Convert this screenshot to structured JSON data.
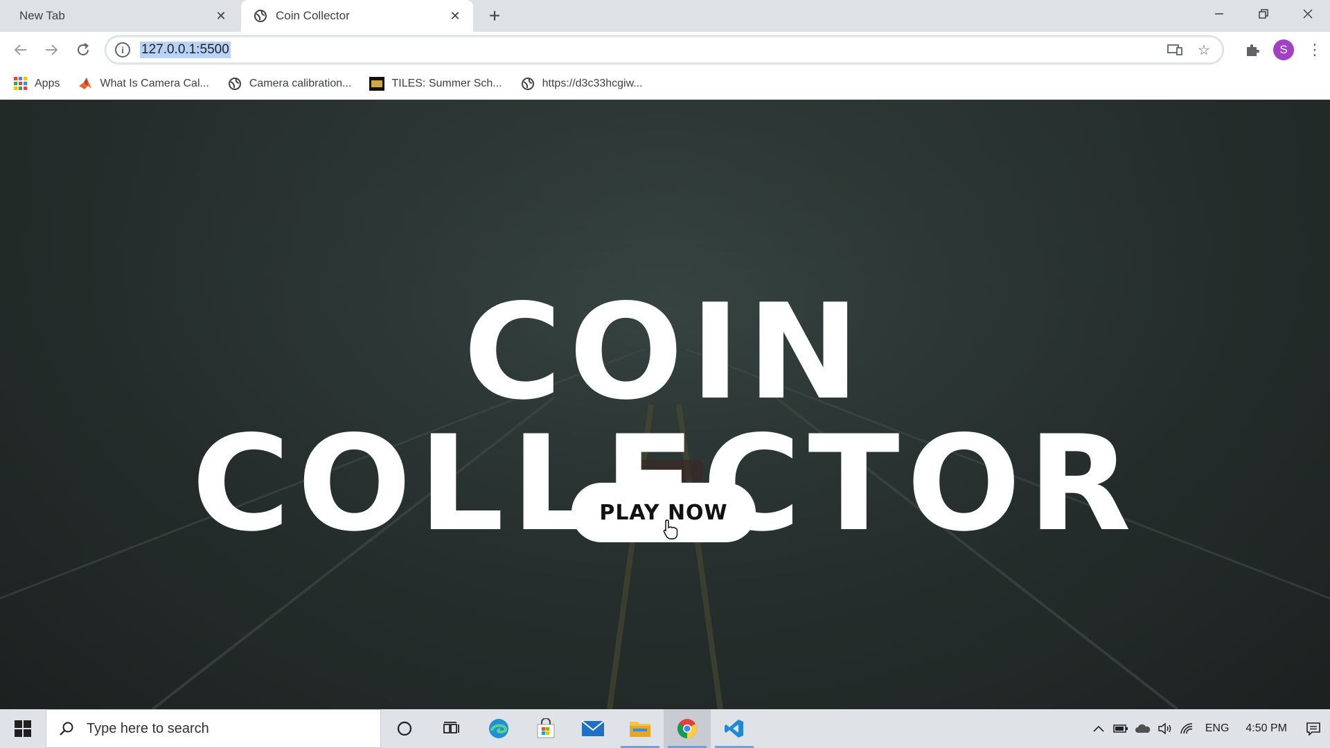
{
  "browser": {
    "tabs": [
      {
        "title": "New Tab",
        "active": false
      },
      {
        "title": "Coin Collector",
        "active": true
      }
    ],
    "new_tab_symbol": "+",
    "url": "127.0.0.1:5500",
    "bookmarks": [
      {
        "label": "Apps",
        "icon": "apps-grid-icon"
      },
      {
        "label": "What Is Camera Cal...",
        "icon": "matlab-icon"
      },
      {
        "label": "Camera calibration...",
        "icon": "globe-icon"
      },
      {
        "label": "TILES: Summer Sch...",
        "icon": "usc-icon"
      },
      {
        "label": "https://d3c33hcgiw...",
        "icon": "globe-icon"
      }
    ],
    "profile_initial": "S"
  },
  "game": {
    "title": "COIN COLLECTOR",
    "play_button": "PLAY NOW"
  },
  "taskbar": {
    "search_placeholder": "Type here to search",
    "language": "ENG",
    "time": "4:50 PM"
  },
  "colors": {
    "accent": "#1a73e8",
    "url_highlight": "#b9d3f7",
    "page_bg": "#283230",
    "taskbar_bg": "#dfe3e8"
  }
}
